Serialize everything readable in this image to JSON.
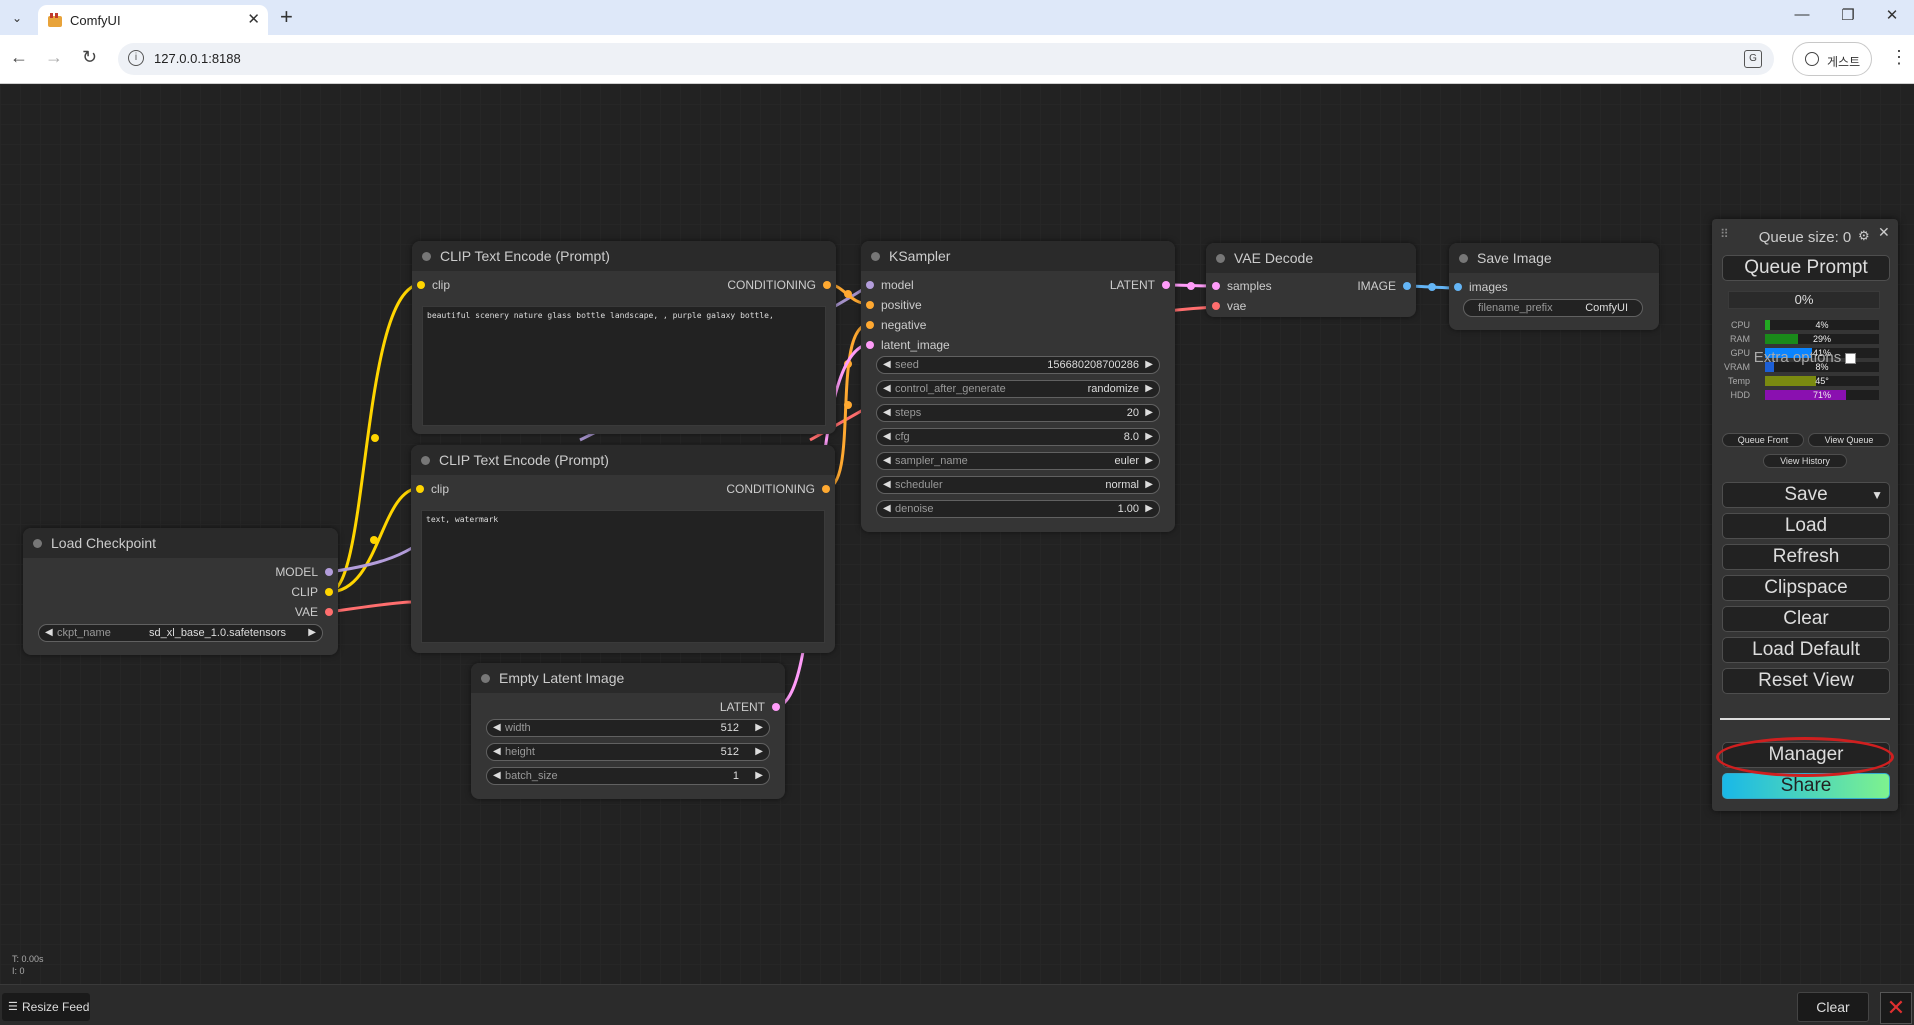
{
  "browser": {
    "tab_title": "ComfyUI",
    "url": "127.0.0.1:8188",
    "profile_label": "게스트"
  },
  "nodes": {
    "clip_pos": {
      "title": "CLIP Text Encode (Prompt)",
      "input": "clip",
      "output": "CONDITIONING",
      "text": "beautiful scenery nature glass bottle landscape, , purple galaxy bottle,"
    },
    "clip_neg": {
      "title": "CLIP Text Encode (Prompt)",
      "input": "clip",
      "output": "CONDITIONING",
      "text": "text, watermark"
    },
    "ksampler": {
      "title": "KSampler",
      "inputs": [
        "model",
        "positive",
        "negative",
        "latent_image"
      ],
      "output": "LATENT",
      "widgets": [
        {
          "name": "seed",
          "value": "156680208700286"
        },
        {
          "name": "control_after_generate",
          "value": "randomize"
        },
        {
          "name": "steps",
          "value": "20"
        },
        {
          "name": "cfg",
          "value": "8.0"
        },
        {
          "name": "sampler_name",
          "value": "euler"
        },
        {
          "name": "scheduler",
          "value": "normal"
        },
        {
          "name": "denoise",
          "value": "1.00"
        }
      ]
    },
    "vae_decode": {
      "title": "VAE Decode",
      "inputs": [
        "samples",
        "vae"
      ],
      "output": "IMAGE"
    },
    "save_image": {
      "title": "Save Image",
      "input": "images",
      "widget": {
        "name": "filename_prefix",
        "value": "ComfyUI"
      }
    },
    "load_checkpoint": {
      "title": "Load Checkpoint",
      "outputs": [
        "MODEL",
        "CLIP",
        "VAE"
      ],
      "widget": {
        "name": "ckpt_name",
        "value": "sd_xl_base_1.0.safetensors"
      }
    },
    "empty_latent": {
      "title": "Empty Latent Image",
      "output": "LATENT",
      "widgets": [
        {
          "name": "width",
          "value": "512"
        },
        {
          "name": "height",
          "value": "512"
        },
        {
          "name": "batch_size",
          "value": "1"
        }
      ]
    }
  },
  "menu": {
    "queue_size": "Queue size: 0",
    "queue_prompt": "Queue Prompt",
    "progress": "0%",
    "stats": [
      {
        "name": "CPU",
        "value": "4%",
        "level": 0.04,
        "color": "#22aa22"
      },
      {
        "name": "RAM",
        "value": "29%",
        "level": 0.29,
        "color": "#1a8a1a"
      },
      {
        "name": "GPU",
        "value": "41%",
        "level": 0.41,
        "color": "#0a84ff"
      },
      {
        "name": "VRAM",
        "value": "8%",
        "level": 0.08,
        "color": "#1d5fd6"
      },
      {
        "name": "Temp",
        "value": "45°",
        "level": 0.45,
        "color": "#7a8a10"
      },
      {
        "name": "HDD",
        "value": "71%",
        "level": 0.71,
        "color": "#8a10b0"
      }
    ],
    "extra_options": "Extra options",
    "queue_front": "Queue Front",
    "view_queue": "View Queue",
    "view_history": "View History",
    "save": "Save",
    "load": "Load",
    "refresh": "Refresh",
    "clipspace": "Clipspace",
    "clear": "Clear",
    "load_default": "Load Default",
    "reset_view": "Reset View",
    "manager": "Manager",
    "share": "Share"
  },
  "status": {
    "line1": "T: 0.00s",
    "line2": "I: 0"
  },
  "feed": {
    "resize": "Resize Feed",
    "clear": "Clear"
  },
  "colors": {
    "clip": "#ffd500",
    "model": "#b39ddb",
    "vae": "#ff6e6e",
    "conditioning": "#ffa931",
    "latent": "#ff9cf9",
    "image": "#64b5f6"
  }
}
